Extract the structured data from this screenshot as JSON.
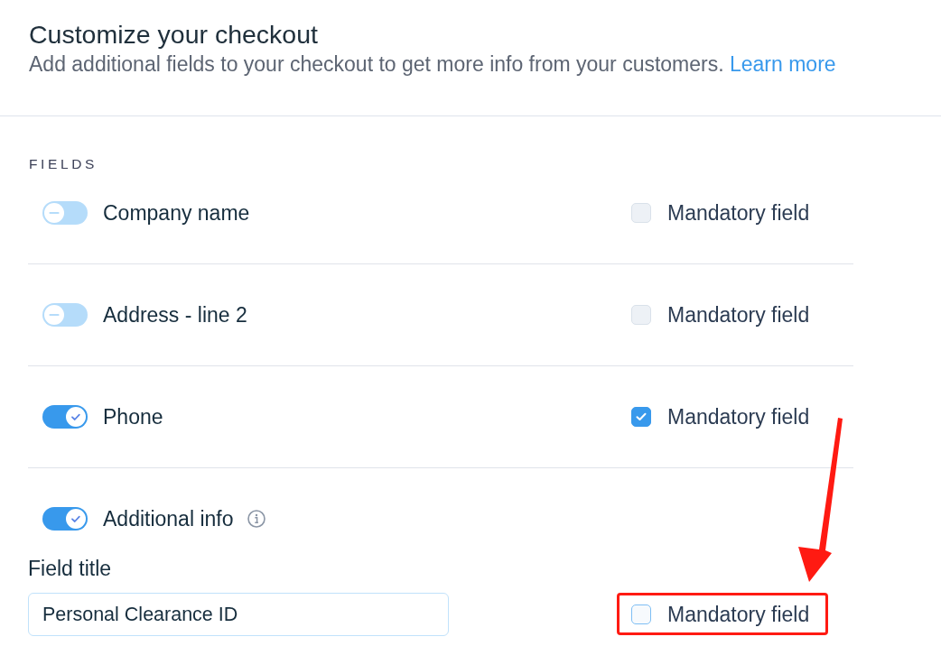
{
  "header": {
    "title": "Customize your checkout",
    "subtitle": "Add additional fields to your checkout to get more info from your customers.",
    "link": "Learn more"
  },
  "section": {
    "heading": "FIELDS"
  },
  "fields": [
    {
      "kind": "basic",
      "label": "Company name",
      "on": false,
      "mandatory": {
        "label": "Mandatory field",
        "checked": false,
        "disabled": true,
        "highlighted": false
      }
    },
    {
      "kind": "basic",
      "label": "Address - line 2",
      "on": false,
      "mandatory": {
        "label": "Mandatory field",
        "checked": false,
        "disabled": true,
        "highlighted": false
      }
    },
    {
      "kind": "basic",
      "label": "Phone",
      "on": true,
      "mandatory": {
        "label": "Mandatory field",
        "checked": true,
        "disabled": false,
        "highlighted": false
      }
    },
    {
      "kind": "custom",
      "label": "Additional info",
      "on": true,
      "title_label": "Field title",
      "title_value": "Personal Clearance ID",
      "mandatory": {
        "label": "Mandatory field",
        "checked": false,
        "disabled": false,
        "highlighted": true
      }
    }
  ]
}
